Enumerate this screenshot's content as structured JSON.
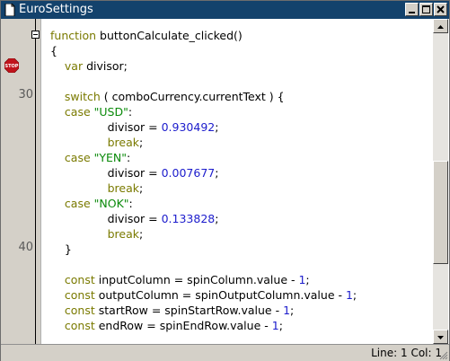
{
  "window": {
    "title": "EuroSettings",
    "colors": {
      "titlebar": "#13426c",
      "keyword": "#7a7a00",
      "number": "#1c1ccc",
      "string": "#0a8a0a"
    }
  },
  "gutter": {
    "line_numbers": [
      "30",
      "40"
    ],
    "breakpoint_icon": "stop-icon",
    "fold_icon": "fold-minus-icon"
  },
  "code": {
    "lines": [
      [
        {
          "t": "function",
          "c": "kw"
        },
        {
          "t": " buttonCalculate_clicked()"
        }
      ],
      [
        {
          "t": "{"
        }
      ],
      [
        {
          "t": "    "
        },
        {
          "t": "var",
          "c": "kw"
        },
        {
          "t": " divisor;"
        }
      ],
      [
        {
          "t": ""
        }
      ],
      [
        {
          "t": "    "
        },
        {
          "t": "switch",
          "c": "kw"
        },
        {
          "t": " ( comboCurrency.currentText ) {"
        }
      ],
      [
        {
          "t": "    "
        },
        {
          "t": "case",
          "c": "kw"
        },
        {
          "t": " "
        },
        {
          "t": "\"USD\"",
          "c": "str"
        },
        {
          "t": ":"
        }
      ],
      [
        {
          "t": "                divisor = "
        },
        {
          "t": "0.930492",
          "c": "num"
        },
        {
          "t": ";"
        }
      ],
      [
        {
          "t": "                "
        },
        {
          "t": "break",
          "c": "kw"
        },
        {
          "t": ";"
        }
      ],
      [
        {
          "t": "    "
        },
        {
          "t": "case",
          "c": "kw"
        },
        {
          "t": " "
        },
        {
          "t": "\"YEN\"",
          "c": "str"
        },
        {
          "t": ":"
        }
      ],
      [
        {
          "t": "                divisor = "
        },
        {
          "t": "0.007677",
          "c": "num"
        },
        {
          "t": ";"
        }
      ],
      [
        {
          "t": "                "
        },
        {
          "t": "break",
          "c": "kw"
        },
        {
          "t": ";"
        }
      ],
      [
        {
          "t": "    "
        },
        {
          "t": "case",
          "c": "kw"
        },
        {
          "t": " "
        },
        {
          "t": "\"NOK\"",
          "c": "str"
        },
        {
          "t": ":"
        }
      ],
      [
        {
          "t": "                divisor = "
        },
        {
          "t": "0.133828",
          "c": "num"
        },
        {
          "t": ";"
        }
      ],
      [
        {
          "t": "                "
        },
        {
          "t": "break",
          "c": "kw"
        },
        {
          "t": ";"
        }
      ],
      [
        {
          "t": "    }"
        }
      ],
      [
        {
          "t": ""
        }
      ],
      [
        {
          "t": "    "
        },
        {
          "t": "const",
          "c": "kw"
        },
        {
          "t": " inputColumn = spinColumn.value - "
        },
        {
          "t": "1",
          "c": "num"
        },
        {
          "t": ";"
        }
      ],
      [
        {
          "t": "    "
        },
        {
          "t": "const",
          "c": "kw"
        },
        {
          "t": " outputColumn = spinOutputColumn.value - "
        },
        {
          "t": "1",
          "c": "num"
        },
        {
          "t": ";"
        }
      ],
      [
        {
          "t": "    "
        },
        {
          "t": "const",
          "c": "kw"
        },
        {
          "t": " startRow = spinStartRow.value - "
        },
        {
          "t": "1",
          "c": "num"
        },
        {
          "t": ";"
        }
      ],
      [
        {
          "t": "    "
        },
        {
          "t": "const",
          "c": "kw"
        },
        {
          "t": " endRow = spinEndRow.value - "
        },
        {
          "t": "1",
          "c": "num"
        },
        {
          "t": ";"
        }
      ]
    ]
  },
  "status": {
    "position": "Line: 1 Col: 1"
  }
}
